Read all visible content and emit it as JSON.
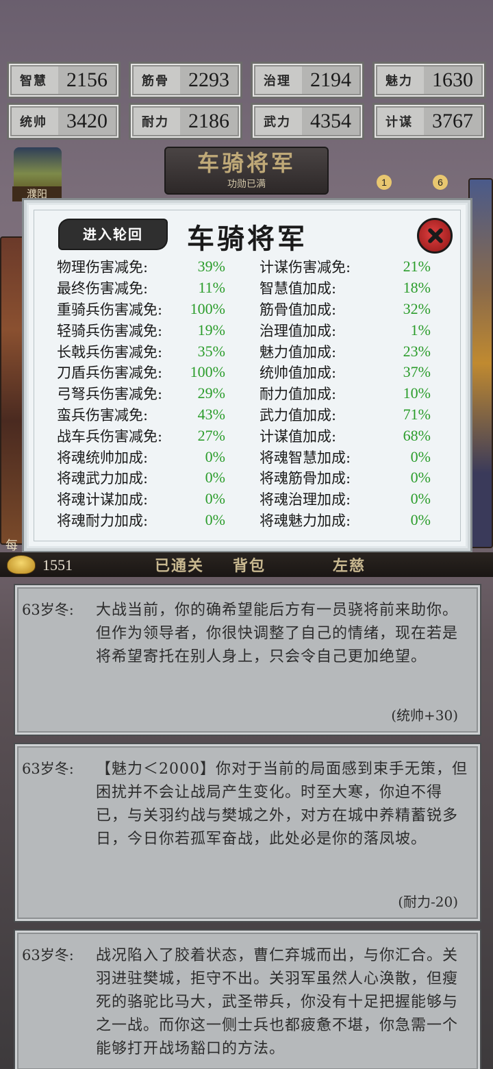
{
  "stats": [
    {
      "name": "智慧",
      "value": "2156"
    },
    {
      "name": "筋骨",
      "value": "2293"
    },
    {
      "name": "治理",
      "value": "2194"
    },
    {
      "name": "魅力",
      "value": "1630"
    },
    {
      "name": "统帅",
      "value": "3420"
    },
    {
      "name": "耐力",
      "value": "2186"
    },
    {
      "name": "武力",
      "value": "4354"
    },
    {
      "name": "计谋",
      "value": "3767"
    }
  ],
  "background": {
    "rank_title": "车骑将军",
    "rank_subtitle": "功勋已满",
    "tower_label": "濮阳",
    "badge_left": "1",
    "badge_right": "6",
    "side_char": "每"
  },
  "modal": {
    "reincarnate_label": "进入轮回",
    "title": "车骑将军",
    "left_bonuses": [
      {
        "label": "物理伤害减免:",
        "value": "39%"
      },
      {
        "label": "最终伤害减免:",
        "value": "11%"
      },
      {
        "label": "重骑兵伤害减免:",
        "value": "100%"
      },
      {
        "label": "轻骑兵伤害减免:",
        "value": "19%"
      },
      {
        "label": "长戟兵伤害减免:",
        "value": "35%"
      },
      {
        "label": "刀盾兵伤害减免:",
        "value": "100%"
      },
      {
        "label": "弓弩兵伤害减免:",
        "value": "29%"
      },
      {
        "label": "蛮兵伤害减免:",
        "value": "43%"
      },
      {
        "label": "战车兵伤害减免:",
        "value": "27%"
      },
      {
        "label": "将魂统帅加成:",
        "value": "0%"
      },
      {
        "label": "将魂武力加成:",
        "value": "0%"
      },
      {
        "label": "将魂计谋加成:",
        "value": "0%"
      },
      {
        "label": "将魂耐力加成:",
        "value": "0%"
      }
    ],
    "right_bonuses": [
      {
        "label": "计谋伤害减免:",
        "value": "21%"
      },
      {
        "label": "智慧值加成:",
        "value": "18%"
      },
      {
        "label": "筋骨值加成:",
        "value": "32%"
      },
      {
        "label": "治理值加成:",
        "value": "1%"
      },
      {
        "label": "魅力值加成:",
        "value": "23%"
      },
      {
        "label": "统帅值加成:",
        "value": "37%"
      },
      {
        "label": "耐力值加成:",
        "value": "10%"
      },
      {
        "label": "武力值加成:",
        "value": "71%"
      },
      {
        "label": "计谋值加成:",
        "value": "68%"
      },
      {
        "label": "将魂智慧加成:",
        "value": "0%"
      },
      {
        "label": "将魂筋骨加成:",
        "value": "0%"
      },
      {
        "label": "将魂治理加成:",
        "value": "0%"
      },
      {
        "label": "将魂魅力加成:",
        "value": "0%"
      }
    ]
  },
  "nav": {
    "gold": "1551",
    "passed_label": "已通关",
    "bag_label": "背包",
    "left_label": "左慈"
  },
  "events": [
    {
      "date": "63岁冬:",
      "text": "大战当前，你的确希望能后方有一员骁将前来助你。但作为领导者，你很快调整了自己的情绪，现在若是将希望寄托在别人身上，只会令自己更加绝望。",
      "effect": "(统帅+30)"
    },
    {
      "date": "63岁冬:",
      "text": "【魅力＜2000】你对于当前的局面感到束手无策，但困扰并不会让战局产生变化。时至大寒，你迫不得已，与关羽约战与樊城之外，对方在城中养精蓄锐多日，今日你若孤军奋战，此处必是你的落凤坡。",
      "effect": "(耐力-20)"
    },
    {
      "date": "63岁冬:",
      "text": "战况陷入了胶着状态，曹仁弃城而出，与你汇合。关羽进驻樊城，拒守不出。关羽军虽然人心涣散，但瘦死的骆驼比马大，武圣带兵，你没有十足把握能够与之一战。而你这一侧士兵也都疲惫不堪，你急需一个能够打开战场豁口的方法。",
      "effect": ""
    }
  ]
}
